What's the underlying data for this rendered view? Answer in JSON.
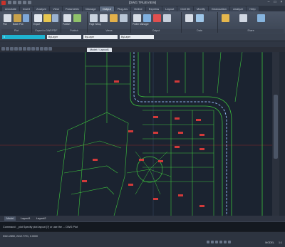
{
  "titlebar": {
    "title": "[DWG TRUEVIEW]"
  },
  "tabs": [
    "Annotate",
    "Insert",
    "Analyze",
    "View",
    "Parametric",
    "Manage",
    "Output",
    "Plug-ins",
    "Online",
    "Express",
    "Layout",
    "Civil 3D",
    "Modify",
    "Geolocation",
    "Analyze",
    "Help"
  ],
  "active_tab_index": 6,
  "ribbon": {
    "groups": [
      {
        "title": "Plot"
      },
      {
        "title": "Export to DWF/PDF"
      },
      {
        "title": "Publish"
      },
      {
        "title": "Views"
      },
      {
        "title": "Output"
      },
      {
        "title": "Data"
      },
      {
        "title": "Share"
      }
    ],
    "buttons": [
      "Plot",
      "Batch Plot",
      "Preview",
      "Export",
      "Publish",
      "3D Print",
      "Page Setup",
      "Plotter Manager",
      "View Details"
    ]
  },
  "propbar": {
    "layer_value": "0",
    "field2": "ByLayer",
    "field3": "ByLayer",
    "field4": "ByLayer"
  },
  "doc_tab": {
    "label": "Model / Layout1"
  },
  "layout_tabs": [
    "Model",
    "Layout1",
    "Layout2"
  ],
  "cmdline": {
    "text": "Command: _plot  Specify plot layout [?]  or use the ...  DWG Plot"
  },
  "status": {
    "coords": "5341.2850, 2412.7721, 0.0000",
    "model_label": "MODEL",
    "scale": "1:1"
  },
  "colors": {
    "canvas": "#1b2330",
    "line_green": "#3ec43e",
    "line_red": "#d23a3a",
    "line_blue": "#8fb5ee"
  }
}
